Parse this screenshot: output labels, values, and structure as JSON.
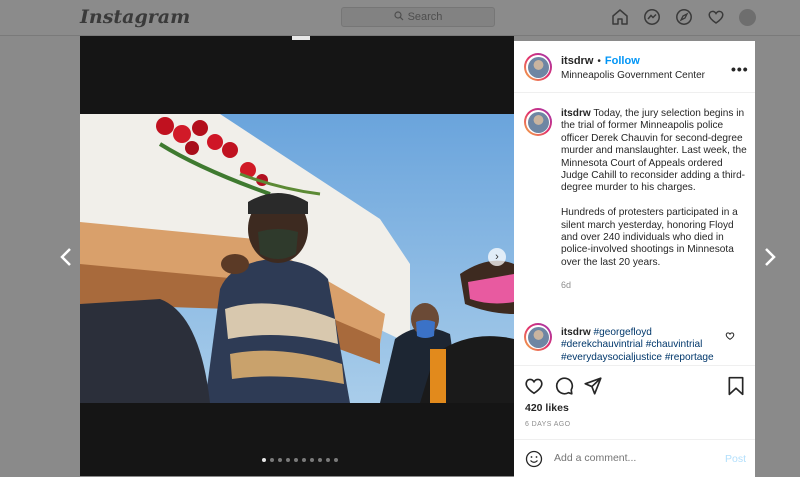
{
  "app": {
    "logo_text": "Instagram"
  },
  "header": {
    "search_placeholder": "Search"
  },
  "post": {
    "author": "itsdrw",
    "follow_label": "Follow",
    "separator": "•",
    "location": "Minneapolis Government Center",
    "caption_paragraphs": [
      "Today, the jury selection begins in the trial of former Minneapolis police officer Derek Chauvin for second-degree murder and manslaughter. Last week, the Minnesota Court of Appeals ordered Judge Cahill to reconsider adding a third-degree murder to his charges.",
      "Hundreds of protesters participated in a silent march yesterday, honoring Floyd and over 240 individuals who died in police-involved shootings in Minnesota over the last 20 years."
    ],
    "caption_age": "6d",
    "comment": {
      "author": "itsdrw",
      "hashtags": [
        "#georgefloyd",
        "#derekchauvintrial",
        "#chauvintrial",
        "#everydaysocialjustice",
        "#reportage"
      ]
    },
    "likes_text": "420 likes",
    "posted_ago": "6 DAYS AGO",
    "comment_placeholder": "Add a comment...",
    "post_button_label": "Post"
  },
  "carousel": {
    "slide_count": 10,
    "active_index": 0
  },
  "icons": {
    "nav": [
      "home-icon",
      "messenger-icon",
      "explore-icon",
      "heart-icon",
      "avatar"
    ],
    "actions": [
      "like-icon",
      "comment-icon",
      "share-icon",
      "save-icon"
    ]
  },
  "colors": {
    "accent": "#0095f6",
    "tag": "#00376b",
    "muted": "#8e8e8e",
    "backdrop": "#8a8a8a"
  }
}
